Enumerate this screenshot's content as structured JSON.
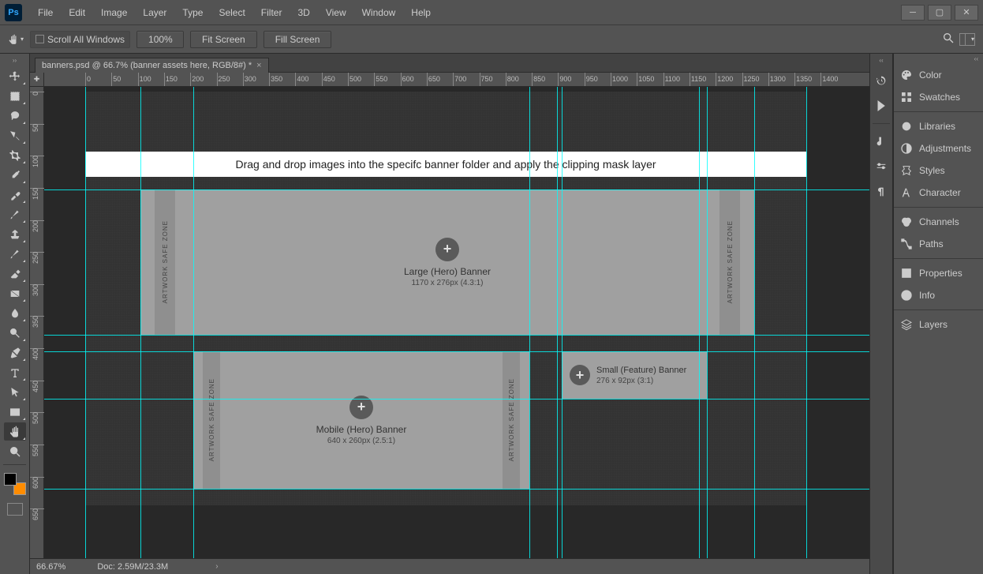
{
  "app": {
    "logo": "Ps"
  },
  "menu": {
    "items": [
      "File",
      "Edit",
      "Image",
      "Layer",
      "Type",
      "Select",
      "Filter",
      "3D",
      "View",
      "Window",
      "Help"
    ]
  },
  "options": {
    "scroll_all_label": "Scroll All Windows",
    "zoom": "100%",
    "fit": "Fit Screen",
    "fill": "Fill Screen"
  },
  "doc": {
    "tab_title": "banners.psd @ 66.7% (banner assets here, RGB/8#) *"
  },
  "rulers": {
    "top": [
      "0",
      "50",
      "100",
      "150",
      "200",
      "250",
      "300",
      "350",
      "400",
      "450",
      "500",
      "550",
      "600",
      "650",
      "700",
      "750",
      "800",
      "850",
      "900",
      "950",
      "1000",
      "1050",
      "1100",
      "1150",
      "1200",
      "1250",
      "1300",
      "1350",
      "1400"
    ],
    "left": [
      "0",
      "50",
      "100",
      "150",
      "200",
      "250",
      "300",
      "350",
      "400",
      "450",
      "500",
      "550",
      "600",
      "650"
    ]
  },
  "canvas": {
    "instruction": "Drag and drop images into the specifc banner folder and apply the clipping mask layer",
    "safe_zone_label": "ARTWORK SAFE ZONE",
    "banners": {
      "large": {
        "title": "Large (Hero) Banner",
        "size": "1170 x 276px (4.3:1)"
      },
      "mobile": {
        "title": "Mobile (Hero) Banner",
        "size": "640 x 260px (2.5:1)"
      },
      "small": {
        "title": "Small (Feature) Banner",
        "size": "276 x 92px (3:1)"
      }
    }
  },
  "right_panels": {
    "items": [
      "Color",
      "Swatches",
      "Libraries",
      "Adjustments",
      "Styles",
      "Character",
      "Channels",
      "Paths",
      "Properties",
      "Info",
      "Layers"
    ]
  },
  "status": {
    "zoom": "66.67%",
    "doc_size": "Doc: 2.59M/23.3M"
  }
}
